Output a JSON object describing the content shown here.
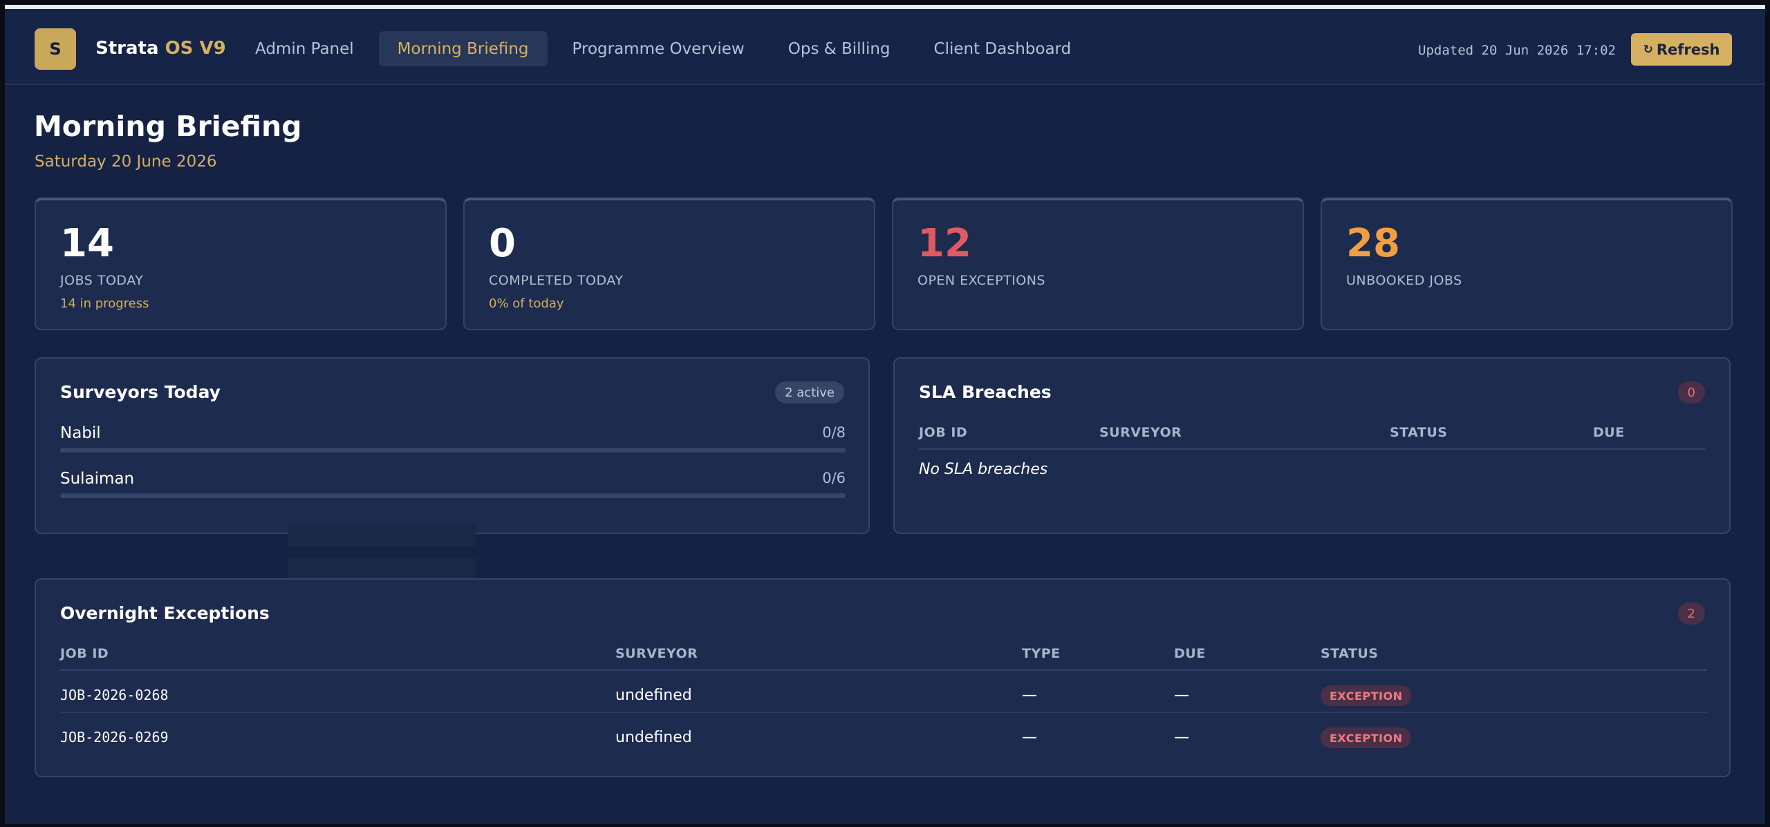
{
  "app": {
    "logo_letter": "S",
    "brand_name": "Strata",
    "brand_version": "OS V9"
  },
  "nav": [
    {
      "label": "Admin Panel",
      "active": false
    },
    {
      "label": "Morning Briefing",
      "active": true
    },
    {
      "label": "Programme Overview",
      "active": false
    },
    {
      "label": "Ops & Billing",
      "active": false
    },
    {
      "label": "Client Dashboard",
      "active": false
    }
  ],
  "header": {
    "updated": "Updated 20 Jun 2026 17:02",
    "refresh_icon": "↻",
    "refresh_label": "Refresh"
  },
  "page": {
    "title": "Morning Briefing",
    "date": "Saturday 20 June 2026"
  },
  "kpis": [
    {
      "value": "14",
      "label": "JOBS TODAY",
      "sub": "14 in progress"
    },
    {
      "value": "0",
      "label": "COMPLETED TODAY",
      "sub": "0% of today"
    },
    {
      "value": "12",
      "label": "OPEN EXCEPTIONS",
      "sub": ""
    },
    {
      "value": "28",
      "label": "UNBOOKED JOBS",
      "sub": ""
    }
  ],
  "surveyors": {
    "title": "Surveyors Today",
    "badge": "2 active",
    "rows": [
      {
        "name": "Nabil",
        "count": "0/8",
        "progress": 0
      },
      {
        "name": "Sulaiman",
        "count": "0/6",
        "progress": 0
      }
    ]
  },
  "sla": {
    "title": "SLA Breaches",
    "badge": "0",
    "columns": [
      "JOB ID",
      "SURVEYOR",
      "STATUS",
      "DUE"
    ],
    "empty_message": "No SLA breaches"
  },
  "exceptions": {
    "title": "Overnight Exceptions",
    "badge": "2",
    "columns": [
      "JOB ID",
      "SURVEYOR",
      "TYPE",
      "DUE",
      "STATUS"
    ],
    "rows": [
      {
        "job_id": "JOB-2026-0268",
        "surveyor": "undefined",
        "type": "—",
        "due": "—",
        "status": "EXCEPTION"
      },
      {
        "job_id": "JOB-2026-0269",
        "surveyor": "undefined",
        "type": "—",
        "due": "—",
        "status": "EXCEPTION"
      }
    ]
  },
  "colors": {
    "background": "#152244",
    "card": "#1d2b4f",
    "accent_gold": "#d4b060",
    "exception_red": "#e05a62",
    "unbooked_orange": "#f0a040"
  }
}
